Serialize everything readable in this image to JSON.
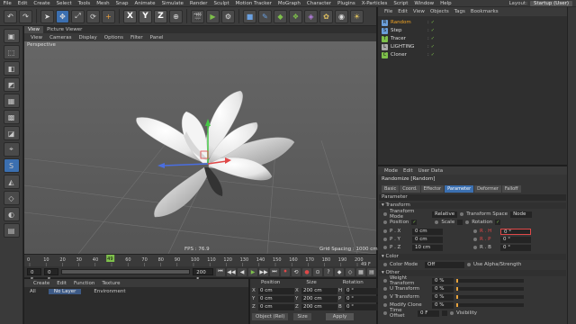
{
  "menubar": {
    "items": [
      "File",
      "Edit",
      "Create",
      "Select",
      "Tools",
      "Mesh",
      "Snap",
      "Animate",
      "Simulate",
      "Render",
      "Sculpt",
      "Motion Tracker",
      "MoGraph",
      "Character",
      "Plugins",
      "X-Particles",
      "Script",
      "Window",
      "Help"
    ],
    "layout_label": "Layout:",
    "layout_value": "Startup (User)"
  },
  "toolbar": {
    "undo": "↶",
    "redo": "↷",
    "select": "➤",
    "move": "✥",
    "scale": "⤢",
    "rotate": "⟳",
    "add": "+",
    "x": "X",
    "y": "Y",
    "z": "Z",
    "coords": "⊕",
    "clapper": "🎬",
    "render_view": "▶",
    "render_settings": "⚙",
    "cube": "■",
    "pen": "✎",
    "subdiv": "◆",
    "array": "❖",
    "deformer": "◈",
    "scene": "✿",
    "camera": "◉",
    "light": "☀"
  },
  "leftbar": [
    "▣",
    "⬚",
    "◧",
    "◩",
    "▦",
    "▩",
    "◪",
    "⌖",
    "S",
    "◭",
    "◇",
    "◐",
    "▤"
  ],
  "viewport": {
    "tabs": [
      "View",
      "Picture Viewer"
    ],
    "menu": [
      "View",
      "Cameras",
      "Display",
      "Options",
      "Filter",
      "Panel"
    ],
    "label": "Perspective",
    "fps": "FPS : 76.9",
    "grid": "Grid Spacing : 1000 cm"
  },
  "timeline": {
    "ticks": [
      "0",
      "10",
      "20",
      "30",
      "40",
      "50",
      "60",
      "70",
      "80",
      "90",
      "100",
      "110",
      "120",
      "130",
      "140",
      "150",
      "160",
      "170",
      "180",
      "190",
      "200"
    ],
    "current_frame_marker": "49",
    "end_label": "49 F"
  },
  "transport": {
    "start": "0 F",
    "current": "0 F",
    "end": "200 F",
    "max": "200 F",
    "buttons": [
      "⏮",
      "◀◀",
      "◀",
      "▶",
      "▶▶",
      "⏭",
      "⏺",
      "⟲",
      "●",
      "⊙",
      "?",
      "◆",
      "◇",
      "▦",
      "▤"
    ]
  },
  "materials": {
    "menu": [
      "Create",
      "Edit",
      "Function",
      "Texture"
    ],
    "filter_all": "All",
    "filter_layer": "No Layer",
    "filter_env": "Environment"
  },
  "coordinates": {
    "headers": [
      "Position",
      "Size",
      "Rotation"
    ],
    "rows": [
      {
        "a": "X",
        "p": "0 cm",
        "s_lab": "X",
        "s": "200 cm",
        "r_lab": "H",
        "r": "0 °"
      },
      {
        "a": "Y",
        "p": "0 cm",
        "s_lab": "Y",
        "s": "200 cm",
        "r_lab": "P",
        "r": "0 °"
      },
      {
        "a": "Z",
        "p": "0 cm",
        "s_lab": "Z",
        "s": "200 cm",
        "r_lab": "B",
        "r": "0 °"
      }
    ],
    "mode": "Object (Rel)",
    "size_mode": "Size",
    "apply": "Apply"
  },
  "object_manager": {
    "menu": [
      "File",
      "Edit",
      "View",
      "Objects",
      "Tags",
      "Bookmarks"
    ],
    "objects": [
      {
        "name": "Random",
        "icon": "R",
        "color": "#6a9ed9"
      },
      {
        "name": "Step",
        "icon": "S",
        "color": "#6a9ed9"
      },
      {
        "name": "Tracer",
        "icon": "T",
        "color": "#7ec04b"
      },
      {
        "name": "LIGHTING",
        "icon": "L",
        "color": "#aaaaaa"
      },
      {
        "name": "Cloner",
        "icon": "C",
        "color": "#7ec04b"
      }
    ]
  },
  "attribute_manager": {
    "menu": [
      "Mode",
      "Edit",
      "User Data"
    ],
    "title": "Randomize [Random]",
    "tabs": [
      "Basic",
      "Coord.",
      "Effector",
      "Parameter",
      "Deformer",
      "Falloff"
    ],
    "active_tab": "Parameter",
    "section_parameter": "Parameter",
    "section_transform": "▾ Transform",
    "transform_mode_label": "Transform Mode",
    "transform_mode_value": "Relative",
    "transform_space_label": "Transform Space",
    "transform_space_value": "Node",
    "position_label": "Position",
    "scale_label": "Scale",
    "rotation_label": "Rotation",
    "px": "0 cm",
    "py": "0 cm",
    "pz": "10 cm",
    "rh": "0 °",
    "rp": "0 °",
    "rb": "0 °",
    "px_lab": "P . X",
    "py_lab": "P . Y",
    "pz_lab": "P . Z",
    "rh_lab": "R . H",
    "rp_lab": "R . P",
    "rb_lab": "R . B",
    "section_color": "▾ Color",
    "color_mode_label": "Color Mode",
    "color_mode_value": "Off",
    "use_alpha_label": "Use Alpha/Strength",
    "section_other": "▾ Other",
    "weight_label": "Weight Transform",
    "weight_value": "0 %",
    "u_label": "U Transform",
    "u_value": "0 %",
    "v_label": "V Transform",
    "v_value": "0 %",
    "clone_label": "Modify Clone",
    "clone_value": "0 %",
    "time_label": "Time Offset",
    "time_value": "0 F",
    "visibility_label": "Visibility"
  }
}
